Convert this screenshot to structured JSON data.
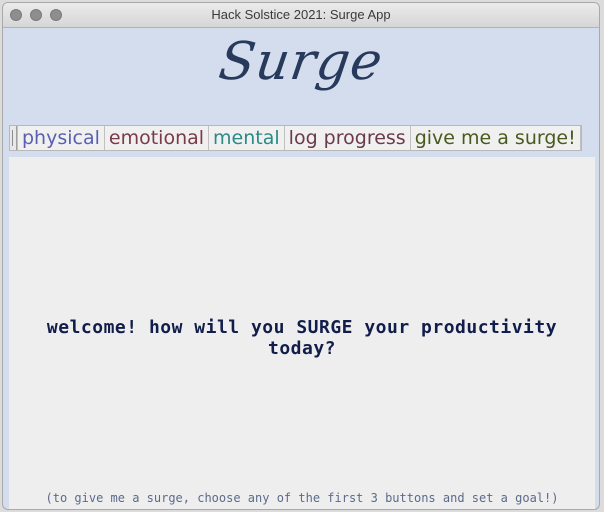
{
  "window": {
    "title": "Hack Solstice 2021: Surge App"
  },
  "header": {
    "logo_text": "Surge"
  },
  "tabs": [
    {
      "label": "physical",
      "color": "#5a5fb0"
    },
    {
      "label": "emotional",
      "color": "#7a3a48"
    },
    {
      "label": "mental",
      "color": "#2a8a86"
    },
    {
      "label": "log progress",
      "color": "#6a3a4a"
    },
    {
      "label": "give me a surge!",
      "color": "#4a5a1e"
    }
  ],
  "main": {
    "welcome": "welcome! how will you SURGE your productivity today?",
    "hint": "(to give me a surge, choose any of the first 3 buttons and set a goal!)"
  }
}
